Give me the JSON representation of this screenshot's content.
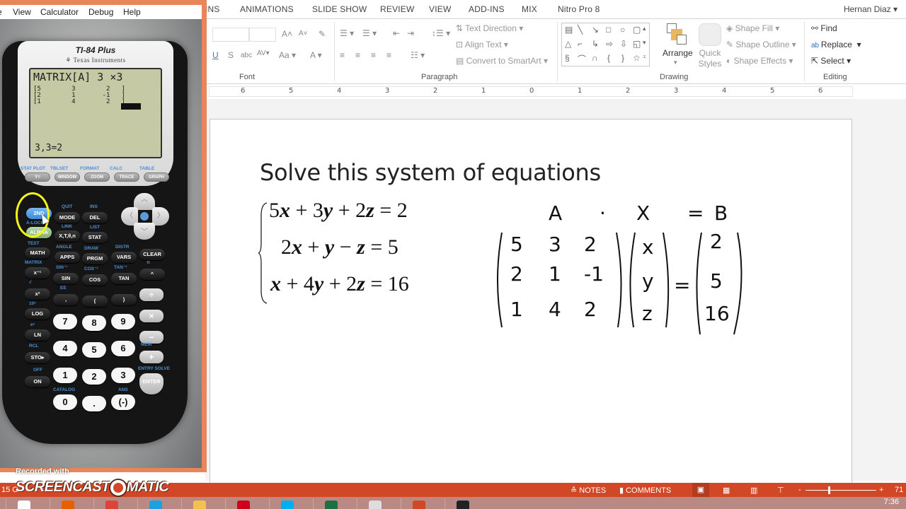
{
  "calculator_window": {
    "menu": [
      "View",
      "Calculator",
      "Debug",
      "Help"
    ],
    "model": "TI-84 Plus",
    "brand": "Texas Instruments",
    "screen": {
      "header": "MATRIX[A] 3 ×3",
      "rows": [
        "[5        3        2   ]",
        "[2        1       -1   ]",
        "[1        4        2   ]"
      ],
      "status": "3,3=2"
    },
    "function_keys": [
      {
        "label": "Y=",
        "second": "STAT PLOT",
        "alpha": "F1"
      },
      {
        "label": "WINDOW",
        "second": "TBLSET",
        "alpha": "F2"
      },
      {
        "label": "ZOOM",
        "second": "FORMAT",
        "alpha": "F3"
      },
      {
        "label": "TRACE",
        "second": "CALC",
        "alpha": "F4"
      },
      {
        "label": "GRAPH",
        "second": "TABLE",
        "alpha": "F5"
      }
    ],
    "keys": {
      "second": "2ND",
      "mode": "MODE",
      "quit": "QUIT",
      "del": "DEL",
      "ins": "INS",
      "alpha": "ALPHA",
      "alock": "A-LOCK",
      "xton": "X,T,θ,n",
      "link": "LINK",
      "stat": "STAT",
      "list": "LIST",
      "math": "MATH",
      "test": "TEST",
      "apps": "APPS",
      "angle": "ANGLE",
      "prgm": "PRGM",
      "draw": "DRAW",
      "vars": "VARS",
      "distr": "DISTR",
      "clear": "CLEAR",
      "inverse": "x⁻¹",
      "matrix": "MATRIX",
      "sin": "SIN",
      "sin_inv": "SIN⁻¹",
      "cos": "COS",
      "cos_inv": "COS⁻¹",
      "tan": "TAN",
      "tan_inv": "TAN⁻¹",
      "power": "^",
      "pi": "π",
      "square": "x²",
      "sqrt": "√",
      "comma": ",",
      "ee": "EE",
      "lparen": "(",
      "rparen": ")",
      "divide": "÷",
      "log": "LOG",
      "tenx": "10ˣ",
      "ln": "LN",
      "ex": "eˣ",
      "sto": "STO▸",
      "rcl": "RCL",
      "on": "ON",
      "off": "OFF",
      "multiply": "×",
      "minus": "−",
      "plus": "+",
      "mem": "MEM",
      "enter": "ENTER",
      "entry_solve": "ENTRY SOLVE",
      "catalog": "CATALOG",
      "ans": "ANS",
      "digits": [
        "7",
        "8",
        "9",
        "4",
        "5",
        "6",
        "1",
        "2",
        "3",
        "0",
        ".",
        "(-)"
      ]
    }
  },
  "powerpoint": {
    "tabs": [
      "INS",
      "ANIMATIONS",
      "SLIDE SHOW",
      "REVIEW",
      "VIEW",
      "ADD-INS",
      "MIX",
      "Nitro Pro 8"
    ],
    "user": "Hernan Diaz",
    "ribbon": {
      "groups": [
        "Font",
        "Paragraph",
        "Drawing",
        "Editing"
      ],
      "paragraph": {
        "text_direction": "Text Direction",
        "align_text": "Align Text",
        "convert_smartart": "Convert to SmartArt"
      },
      "drawing": {
        "arrange": "Arrange",
        "quick_styles": "Quick Styles",
        "shape_fill": "Shape Fill",
        "shape_outline": "Shape Outline",
        "shape_effects": "Shape Effects"
      },
      "editing": {
        "find": "Find",
        "replace": "Replace",
        "select": "Select"
      }
    },
    "ruler_marks": [
      "6",
      "5",
      "4",
      "3",
      "2",
      "1",
      "0",
      "1",
      "2",
      "3",
      "4",
      "5",
      "6"
    ],
    "slide": {
      "title": "Solve this system of equations",
      "equations": [
        {
          "parts": [
            "5",
            "x",
            " + 3",
            "y",
            " + 2",
            "z",
            " = 2"
          ]
        },
        {
          "parts": [
            "2",
            "x",
            " + ",
            "y",
            " − ",
            "z",
            " = 5"
          ]
        },
        {
          "parts": [
            "",
            "x",
            " + 4",
            "y",
            " + 2",
            "z",
            " = 16"
          ]
        }
      ],
      "handwriting": {
        "labels": {
          "a": "A",
          "dot": "·",
          "x": "X",
          "eq": "=",
          "b": "B"
        },
        "matrix_a": [
          [
            "5",
            "3",
            "2"
          ],
          [
            "2",
            "1",
            "-1"
          ],
          [
            "1",
            "4",
            "2"
          ]
        ],
        "vector_x": [
          "x",
          "y",
          "z"
        ],
        "vector_b": [
          "2",
          "5",
          "16"
        ],
        "equals": "="
      }
    },
    "status_bar": {
      "left": "15 O",
      "notes": "NOTES",
      "comments": "COMMENTS",
      "zoom_minus": "-",
      "zoom_plus": "+",
      "zoom_level": "71"
    }
  },
  "taskbar": {
    "items": [
      "start",
      "firefox",
      "chrome",
      "internet-explorer",
      "file-explorer",
      "acrobat",
      "skype",
      "excel",
      "calculator-emulator",
      "powerpoint",
      "screen-capture"
    ],
    "clock": "7:36"
  },
  "watermark": {
    "small": "Recorded with",
    "big_left": "SCREENCAST",
    "big_right": "MATIC"
  }
}
